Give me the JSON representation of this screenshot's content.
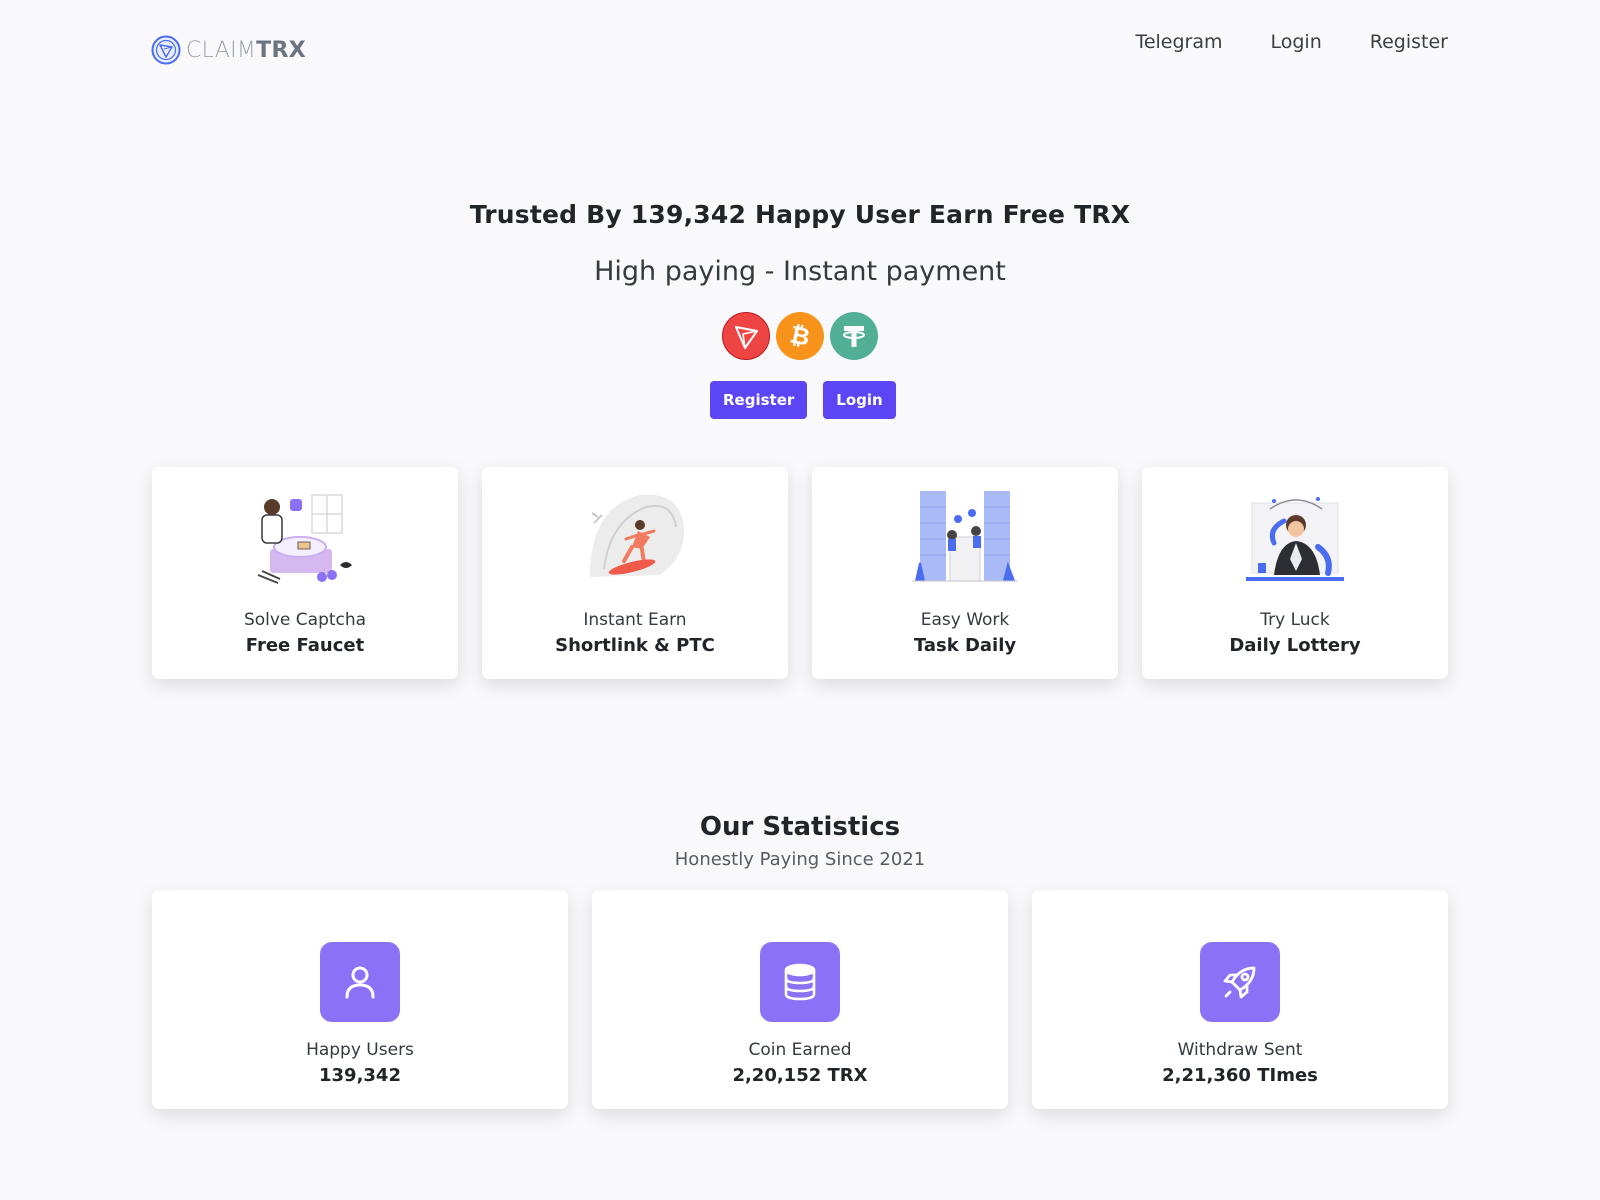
{
  "header": {
    "logo_light": "CLAIM",
    "logo_bold": "TRX",
    "nav": [
      "Telegram",
      "Login",
      "Register"
    ]
  },
  "hero": {
    "title": "Trusted By 139,342 Happy User Earn Free TRX",
    "subtitle": "High paying - Instant payment",
    "coins": [
      "tron-icon",
      "bitcoin-icon",
      "tether-icon"
    ],
    "buttons": [
      "Register",
      "Login"
    ]
  },
  "features": [
    {
      "small": "Solve Captcha",
      "big": "Free Faucet",
      "illustration": "captcha-illustration"
    },
    {
      "small": "Instant Earn",
      "big": "Shortlink & PTC",
      "illustration": "surfer-illustration"
    },
    {
      "small": "Easy Work",
      "big": "Task Daily",
      "illustration": "task-illustration"
    },
    {
      "small": "Try Luck",
      "big": "Daily Lottery",
      "illustration": "lottery-illustration"
    }
  ],
  "stats": {
    "title": "Our Statistics",
    "subtitle": "Honestly Paying Since 2021",
    "items": [
      {
        "label": "Happy Users",
        "value": "139,342",
        "icon": "user-icon"
      },
      {
        "label": "Coin Earned",
        "value": "2,20,152 TRX",
        "icon": "database-icon"
      },
      {
        "label": "Withdraw Sent",
        "value": "2,21,360 TImes",
        "icon": "rocket-icon"
      }
    ]
  },
  "colors": {
    "accent": "#5b45f5",
    "icon_bg": "#8b71f5",
    "background": "#f9f9fb",
    "tron": "#ef4444",
    "bitcoin": "#f7931a",
    "tether": "#50af95"
  }
}
